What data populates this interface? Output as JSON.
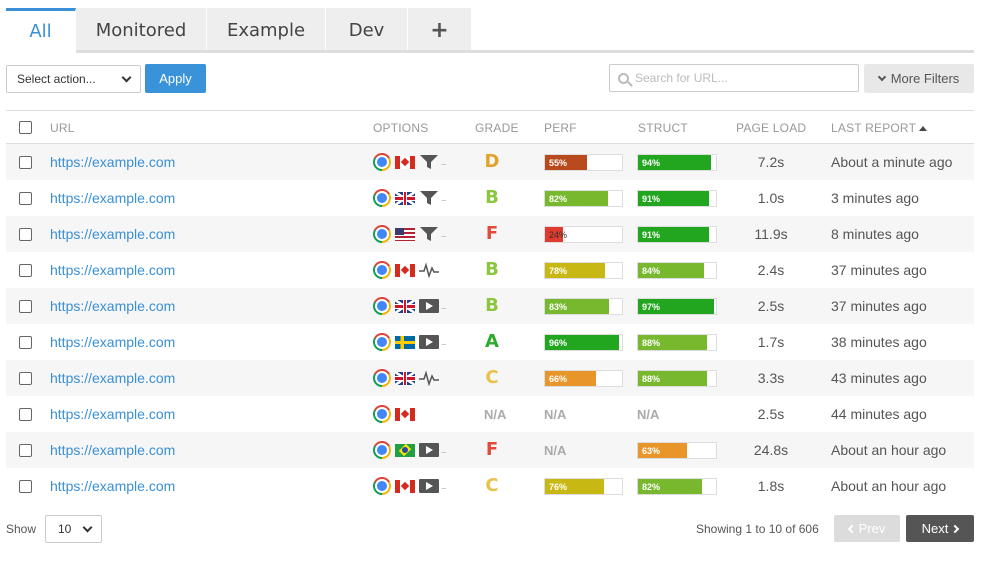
{
  "tabs": [
    {
      "label": "All",
      "active": true
    },
    {
      "label": "Monitored",
      "active": false
    },
    {
      "label": "Example",
      "active": false
    },
    {
      "label": "Dev",
      "active": false
    },
    {
      "label": "+",
      "active": false
    }
  ],
  "toolbar": {
    "action_select_value": "Select action...",
    "apply_label": "Apply",
    "search_placeholder": "Search for URL...",
    "more_filters_label": "More Filters"
  },
  "columns": {
    "url": "URL",
    "options": "OPTIONS",
    "grade": "GRADE",
    "perf": "PERF",
    "struct": "STRUCT",
    "page_load": "PAGE LOAD",
    "last_report": "LAST REPORT"
  },
  "colors": {
    "accent": "#3a8fd6",
    "grade_A": "#2eaa2e",
    "grade_B": "#8cc63f",
    "grade_C": "#e8c24a",
    "grade_D": "#e0a32a",
    "grade_F": "#e04b3a"
  },
  "rows": [
    {
      "url": "https://example.com",
      "browser": "chrome-icon",
      "flag": "ca",
      "option": "funnel",
      "more": true,
      "grade": "D",
      "perf": {
        "value": 55,
        "label": "55%",
        "color": "#b84a1e"
      },
      "struct": {
        "value": 94,
        "label": "94%",
        "color": "#22a51f"
      },
      "load": "7.2s",
      "last": "About a minute ago"
    },
    {
      "url": "https://example.com",
      "browser": "chrome-icon",
      "flag": "gb",
      "option": "funnel",
      "more": true,
      "grade": "B",
      "perf": {
        "value": 82,
        "label": "82%",
        "color": "#77b82e"
      },
      "struct": {
        "value": 91,
        "label": "91%",
        "color": "#22a51f"
      },
      "load": "1.0s",
      "last": "3 minutes ago"
    },
    {
      "url": "https://example.com",
      "browser": "chrome-icon",
      "flag": "us",
      "option": "funnel",
      "more": true,
      "grade": "F",
      "perf": {
        "value": 24,
        "label": "24%",
        "color": "#e03b2e"
      },
      "struct": {
        "value": 91,
        "label": "91%",
        "color": "#22a51f"
      },
      "load": "11.9s",
      "last": "8 minutes ago"
    },
    {
      "url": "https://example.com",
      "browser": "chrome-icon",
      "flag": "ca",
      "option": "pulse",
      "more": false,
      "grade": "B",
      "perf": {
        "value": 78,
        "label": "78%",
        "color": "#c8b814"
      },
      "struct": {
        "value": 84,
        "label": "84%",
        "color": "#77b82e"
      },
      "load": "2.4s",
      "last": "37 minutes ago"
    },
    {
      "url": "https://example.com",
      "browser": "chrome-icon",
      "flag": "gb",
      "option": "play",
      "more": true,
      "grade": "B",
      "perf": {
        "value": 83,
        "label": "83%",
        "color": "#77b82e"
      },
      "struct": {
        "value": 97,
        "label": "97%",
        "color": "#22a51f"
      },
      "load": "2.5s",
      "last": "37 minutes ago"
    },
    {
      "url": "https://example.com",
      "browser": "chrome-icon",
      "flag": "se",
      "option": "play",
      "more": true,
      "grade": "A",
      "perf": {
        "value": 96,
        "label": "96%",
        "color": "#22a51f"
      },
      "struct": {
        "value": 88,
        "label": "88%",
        "color": "#77b82e"
      },
      "load": "1.7s",
      "last": "38 minutes ago"
    },
    {
      "url": "https://example.com",
      "browser": "chrome-icon",
      "flag": "gb",
      "option": "pulse",
      "more": false,
      "grade": "C",
      "perf": {
        "value": 66,
        "label": "66%",
        "color": "#e8962a"
      },
      "struct": {
        "value": 88,
        "label": "88%",
        "color": "#77b82e"
      },
      "load": "3.3s",
      "last": "43 minutes ago"
    },
    {
      "url": "https://example.com",
      "browser": "chrome-icon",
      "flag": "ca",
      "option": "",
      "more": false,
      "grade": "N/A",
      "perf": null,
      "perf_na": "N/A",
      "struct": null,
      "struct_na": "N/A",
      "load": "2.5s",
      "last": "44 minutes ago"
    },
    {
      "url": "https://example.com",
      "browser": "chrome-icon",
      "flag": "br",
      "option": "play",
      "more": true,
      "grade": "F",
      "perf": null,
      "perf_na": "N/A",
      "struct": {
        "value": 63,
        "label": "63%",
        "color": "#e8962a"
      },
      "load": "24.8s",
      "last": "About an hour ago"
    },
    {
      "url": "https://example.com",
      "browser": "chrome-icon",
      "flag": "ca",
      "option": "play",
      "more": true,
      "grade": "C",
      "perf": {
        "value": 76,
        "label": "76%",
        "color": "#c8b814"
      },
      "struct": {
        "value": 82,
        "label": "82%",
        "color": "#77b82e"
      },
      "load": "1.8s",
      "last": "About an hour ago"
    }
  ],
  "footer": {
    "show_label": "Show",
    "show_value": "10",
    "showing_text": "Showing 1 to 10 of 606",
    "prev_label": "Prev",
    "next_label": "Next"
  }
}
